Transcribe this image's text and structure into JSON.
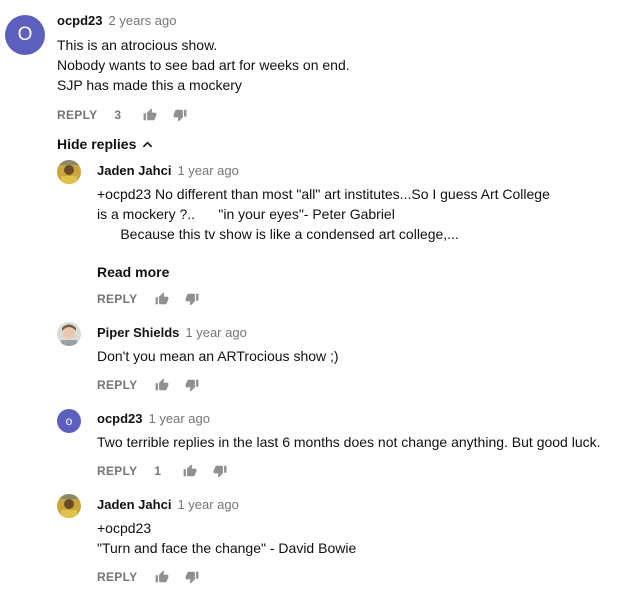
{
  "top_comment": {
    "avatar_letter": "O",
    "author": "ocpd23",
    "time": "2 years ago",
    "lines": [
      "This is an atrocious show.",
      "Nobody wants to see bad art for weeks on end.",
      "SJP has made this a mockery"
    ],
    "reply_label": "REPLY",
    "likes": "3"
  },
  "hide_replies_label": "Hide replies",
  "replies": [
    {
      "author": "Jaden Jahci",
      "time": "1 year ago",
      "lines": [
        "+ocpd23 No different than most \"all\" art institutes...So I guess Art College",
        "is a mockery ?..      \"in your eyes\"- Peter Gabriel",
        "",
        "      Because this tv show is like a condensed art college,..."
      ],
      "read_more": "Read more",
      "reply_label": "REPLY"
    },
    {
      "author": "Piper Shields",
      "time": "1 year ago",
      "lines": [
        "Don't you mean an ARTrocious show ;)"
      ],
      "reply_label": "REPLY"
    },
    {
      "avatar_letter": "o",
      "author": "ocpd23",
      "time": "1 year ago",
      "lines": [
        "Two terrible replies in the last 6 months does not change anything. But good luck."
      ],
      "reply_label": "REPLY",
      "likes": "1"
    },
    {
      "author": "Jaden Jahci",
      "time": "1 year ago",
      "lines": [
        "+ocpd23",
        "\"Turn and face the change\" - David Bowie"
      ],
      "reply_label": "REPLY"
    }
  ],
  "colors": {
    "avatar_bg": "#5c5fbd",
    "meta_gray": "#767676",
    "icon_gray": "#909090"
  },
  "icons": [
    "thumb-up-icon",
    "thumb-down-icon",
    "chevron-up-icon"
  ]
}
